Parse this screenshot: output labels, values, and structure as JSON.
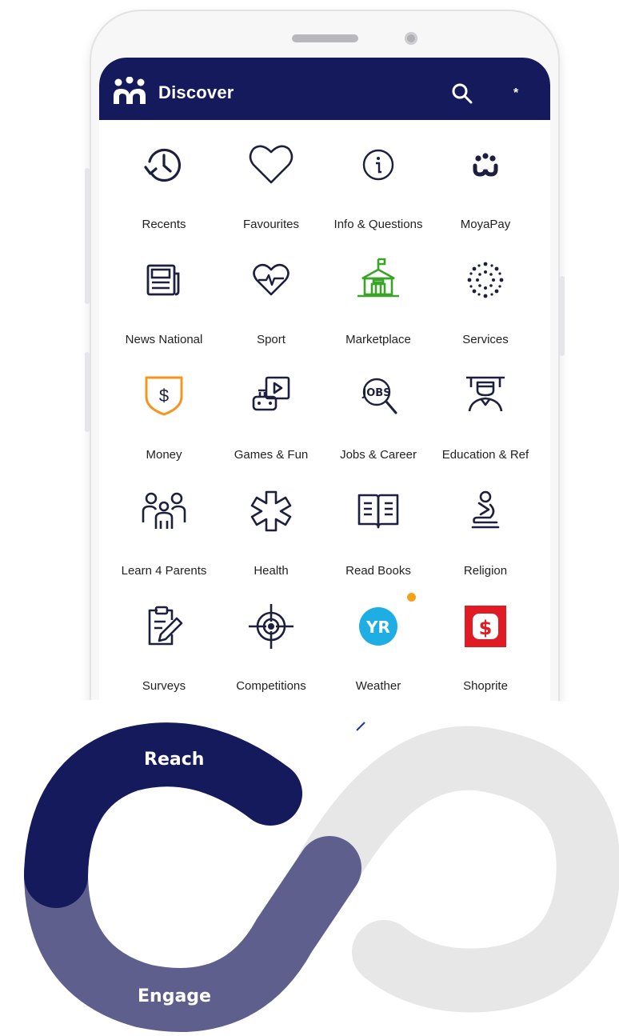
{
  "app": {
    "title": "Discover",
    "more_glyph": "*",
    "colors": {
      "header": "#141a5c",
      "icon": "#1d1f3f",
      "green": "#3aa428",
      "orange": "#f7941d",
      "weather": "#1eaee4",
      "shoprite": "#e11b24"
    }
  },
  "grid": [
    {
      "label": "Recents",
      "icon": "clock-history-icon"
    },
    {
      "label": "Favourites",
      "icon": "heart-icon"
    },
    {
      "label": "Info & Questions",
      "icon": "info-icon"
    },
    {
      "label": "MoyaPay",
      "icon": "moyapay-icon"
    },
    {
      "label": "News National",
      "icon": "newspaper-icon"
    },
    {
      "label": "Sport",
      "icon": "heart-pulse-icon"
    },
    {
      "label": "Marketplace",
      "icon": "building-icon"
    },
    {
      "label": "Services",
      "icon": "dots-circle-icon"
    },
    {
      "label": "Money",
      "icon": "shield-dollar-icon"
    },
    {
      "label": "Games & Fun",
      "icon": "games-icon"
    },
    {
      "label": "Jobs & Career",
      "icon": "jobs-search-icon"
    },
    {
      "label": "Education & Ref",
      "icon": "teacher-icon"
    },
    {
      "label": "Learn 4 Parents",
      "icon": "family-icon"
    },
    {
      "label": "Health",
      "icon": "medical-cross-icon"
    },
    {
      "label": "Read Books",
      "icon": "book-icon"
    },
    {
      "label": "Religion",
      "icon": "praying-icon"
    },
    {
      "label": "Surveys",
      "icon": "clipboard-edit-icon"
    },
    {
      "label": "Competitions",
      "icon": "target-icon"
    },
    {
      "label": "Weather",
      "icon": "yr-logo-icon"
    },
    {
      "label": "Shoprite",
      "icon": "shoprite-logo-icon"
    }
  ],
  "weather_logo_text": "YR",
  "infinity": {
    "reach_label": "Reach",
    "engage_label": "Engage",
    "colors": {
      "reach": "#141a5c",
      "engage": "#5f5f8e",
      "grey": "#e7e7e8"
    }
  }
}
